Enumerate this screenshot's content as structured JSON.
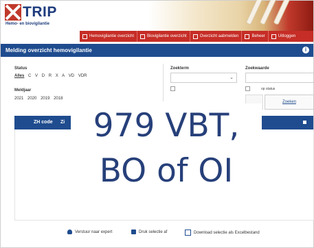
{
  "app": {
    "logo_text": "TRIP",
    "logo_subtitle": "Hemo- en biovigilantie"
  },
  "nav": {
    "items": [
      {
        "label": "Hemovigilantie overzicht"
      },
      {
        "label": "Biovigilantie overzicht"
      },
      {
        "label": "Overzicht aabmelden"
      },
      {
        "label": "Beheer"
      },
      {
        "label": "Uitloggen"
      }
    ]
  },
  "page": {
    "title": "Melding overzicht hemovigilantie"
  },
  "filters": {
    "status_label": "Status",
    "status_options": [
      "Alles",
      "C",
      "V",
      "D",
      "R",
      "X",
      "A",
      "VD",
      "VDR"
    ],
    "year_label": "Meldjaar",
    "year_options": [
      "2021",
      "2020",
      "2019",
      "2018"
    ],
    "search_term_label": "Zoekterm",
    "search_value_label": "Zoekwaarde",
    "checkbox_label": "op status",
    "search_button": "Zoeken"
  },
  "table": {
    "columns": [
      "ZH code",
      "Zi"
    ]
  },
  "overlay": {
    "line1": "979 VBT,",
    "line2": "BO of OI"
  },
  "footer": {
    "send_expert": "Verstuur naar expert",
    "print_selection": "Druk selectie af",
    "download_excel": "Download selectie als Excelbestand"
  },
  "colors": {
    "brand_blue": "#1f4c8f",
    "nav_red": "#c62d26",
    "overlay_text": "#27407a"
  }
}
